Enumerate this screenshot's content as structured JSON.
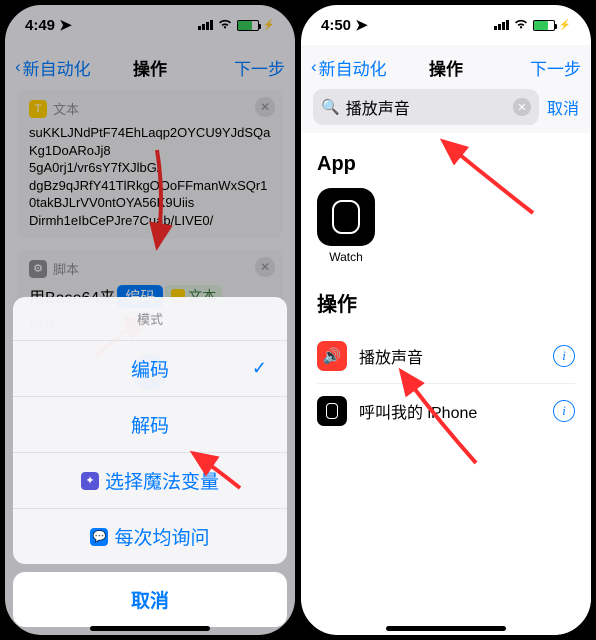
{
  "left": {
    "status": {
      "time": "4:49",
      "loc_icon": "location-icon"
    },
    "nav": {
      "back": "新自动化",
      "title": "操作",
      "next": "下一步"
    },
    "text_card": {
      "badge": "文本",
      "content": "suKKLJNdPtF74EhLaqp2OYCU9YJdSQaKg1DoARoJj8\n5gA0rj1/vr6sY7fXJlbG/\ndgBz9qJRfY41TlRkgOOoFFmanWxSQr10takBJLrVV0ntOYA56K9Uiis\nDirmh1eIbCePJre7Cuab/LIVE0/"
    },
    "script_card": {
      "badge": "脚本",
      "prefix": "用Base64来",
      "mode_pill": "编码",
      "var_pill": "文本",
      "expand": "展开"
    },
    "sheet": {
      "title": "模式",
      "opt_encode": "编码",
      "opt_decode": "解码",
      "opt_magic": "选择魔法变量",
      "opt_ask": "每次均询问",
      "cancel": "取消"
    }
  },
  "right": {
    "status": {
      "time": "4:50"
    },
    "nav": {
      "back": "新自动化",
      "title": "操作",
      "next": "下一步"
    },
    "search": {
      "query": "播放声音",
      "cancel": "取消"
    },
    "app_section": {
      "title": "App",
      "app1": "Watch"
    },
    "actions_section": {
      "title": "操作",
      "row1": "播放声音",
      "row2": "呼叫我的 iPhone"
    }
  }
}
